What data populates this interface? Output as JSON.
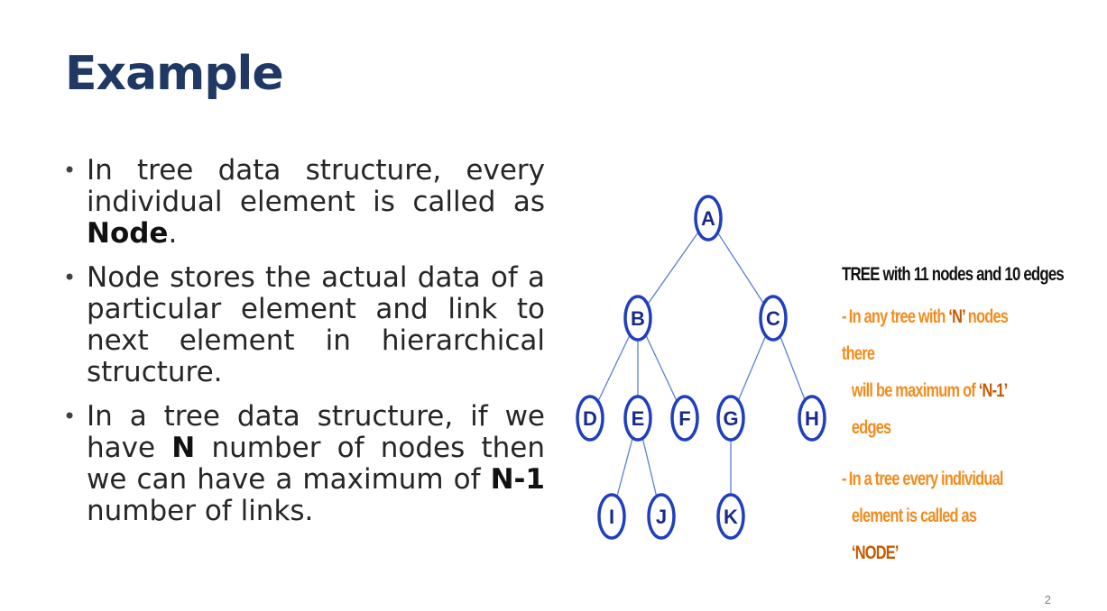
{
  "slide": {
    "title": "Example",
    "page_number": "2",
    "bullets": [
      {
        "parts": [
          {
            "text": "In tree data structure, every individual element is called as ",
            "bold": false
          },
          {
            "text": "Node",
            "bold": true
          },
          {
            "text": ".",
            "bold": false
          }
        ]
      },
      {
        "parts": [
          {
            "text": "Node stores the actual data of a particular element and link to next element in hierarchical structure.",
            "bold": false
          }
        ]
      },
      {
        "parts": [
          {
            "text": "In a tree data structure, if we have ",
            "bold": false
          },
          {
            "text": "N",
            "bold": true
          },
          {
            "text": " number of nodes then we can have a maximum of ",
            "bold": false
          },
          {
            "text": "N-1",
            "bold": true
          },
          {
            "text": " number of links.",
            "bold": false
          }
        ]
      }
    ]
  },
  "figure": {
    "heading": "TREE with 11 nodes and 10 edges",
    "note1": {
      "dash": "-",
      "line1_a": "In any tree with ",
      "line1_b": "‘N’",
      "line1_c": " nodes there",
      "line2_a": "will be maximum of ",
      "line2_b": "‘N-1’",
      "line2_c": " edges"
    },
    "note2": {
      "dash": "-",
      "line1": "In a tree every individual",
      "line2_a": "element is called as ",
      "line2_b": "‘NODE’"
    },
    "colors": {
      "node_stroke": "#1f3fbf",
      "node_fill": "#ffffff",
      "edge": "#5b7fd6",
      "label": "#1a2a8a"
    },
    "nodes": [
      "A",
      "B",
      "C",
      "D",
      "E",
      "F",
      "G",
      "H",
      "I",
      "J",
      "K"
    ],
    "edges": [
      [
        "A",
        "B"
      ],
      [
        "A",
        "C"
      ],
      [
        "B",
        "D"
      ],
      [
        "B",
        "E"
      ],
      [
        "B",
        "F"
      ],
      [
        "C",
        "G"
      ],
      [
        "C",
        "H"
      ],
      [
        "E",
        "I"
      ],
      [
        "E",
        "J"
      ],
      [
        "G",
        "K"
      ]
    ]
  }
}
